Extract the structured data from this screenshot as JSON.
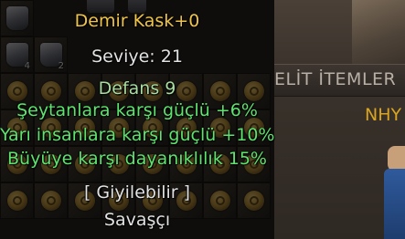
{
  "tooltip": {
    "item_name": "Demir Kask+0",
    "level": "Seviye: 21",
    "defense": "Defans 9",
    "bonus_1": "Şeytanlara karşı güçlü +6%",
    "bonus_2": "Yarı insanlara karşı güçlü +10%",
    "bonus_3": "Büyüye karşı dayanıklılık 15%",
    "equip_status": "[ Giyilebilir ]",
    "class_req": "Savaşçı"
  },
  "inventory": {
    "slot_quantities": [
      "4",
      "2"
    ]
  },
  "side_panel": {
    "header": "ELİT İTEMLER",
    "npc_text": "NHY"
  },
  "colors": {
    "title": "#f0c44a",
    "bonus": "#5fe36f",
    "defense": "#a8dca0",
    "text": "#e2e2e2",
    "npc_text": "#d9a521"
  }
}
